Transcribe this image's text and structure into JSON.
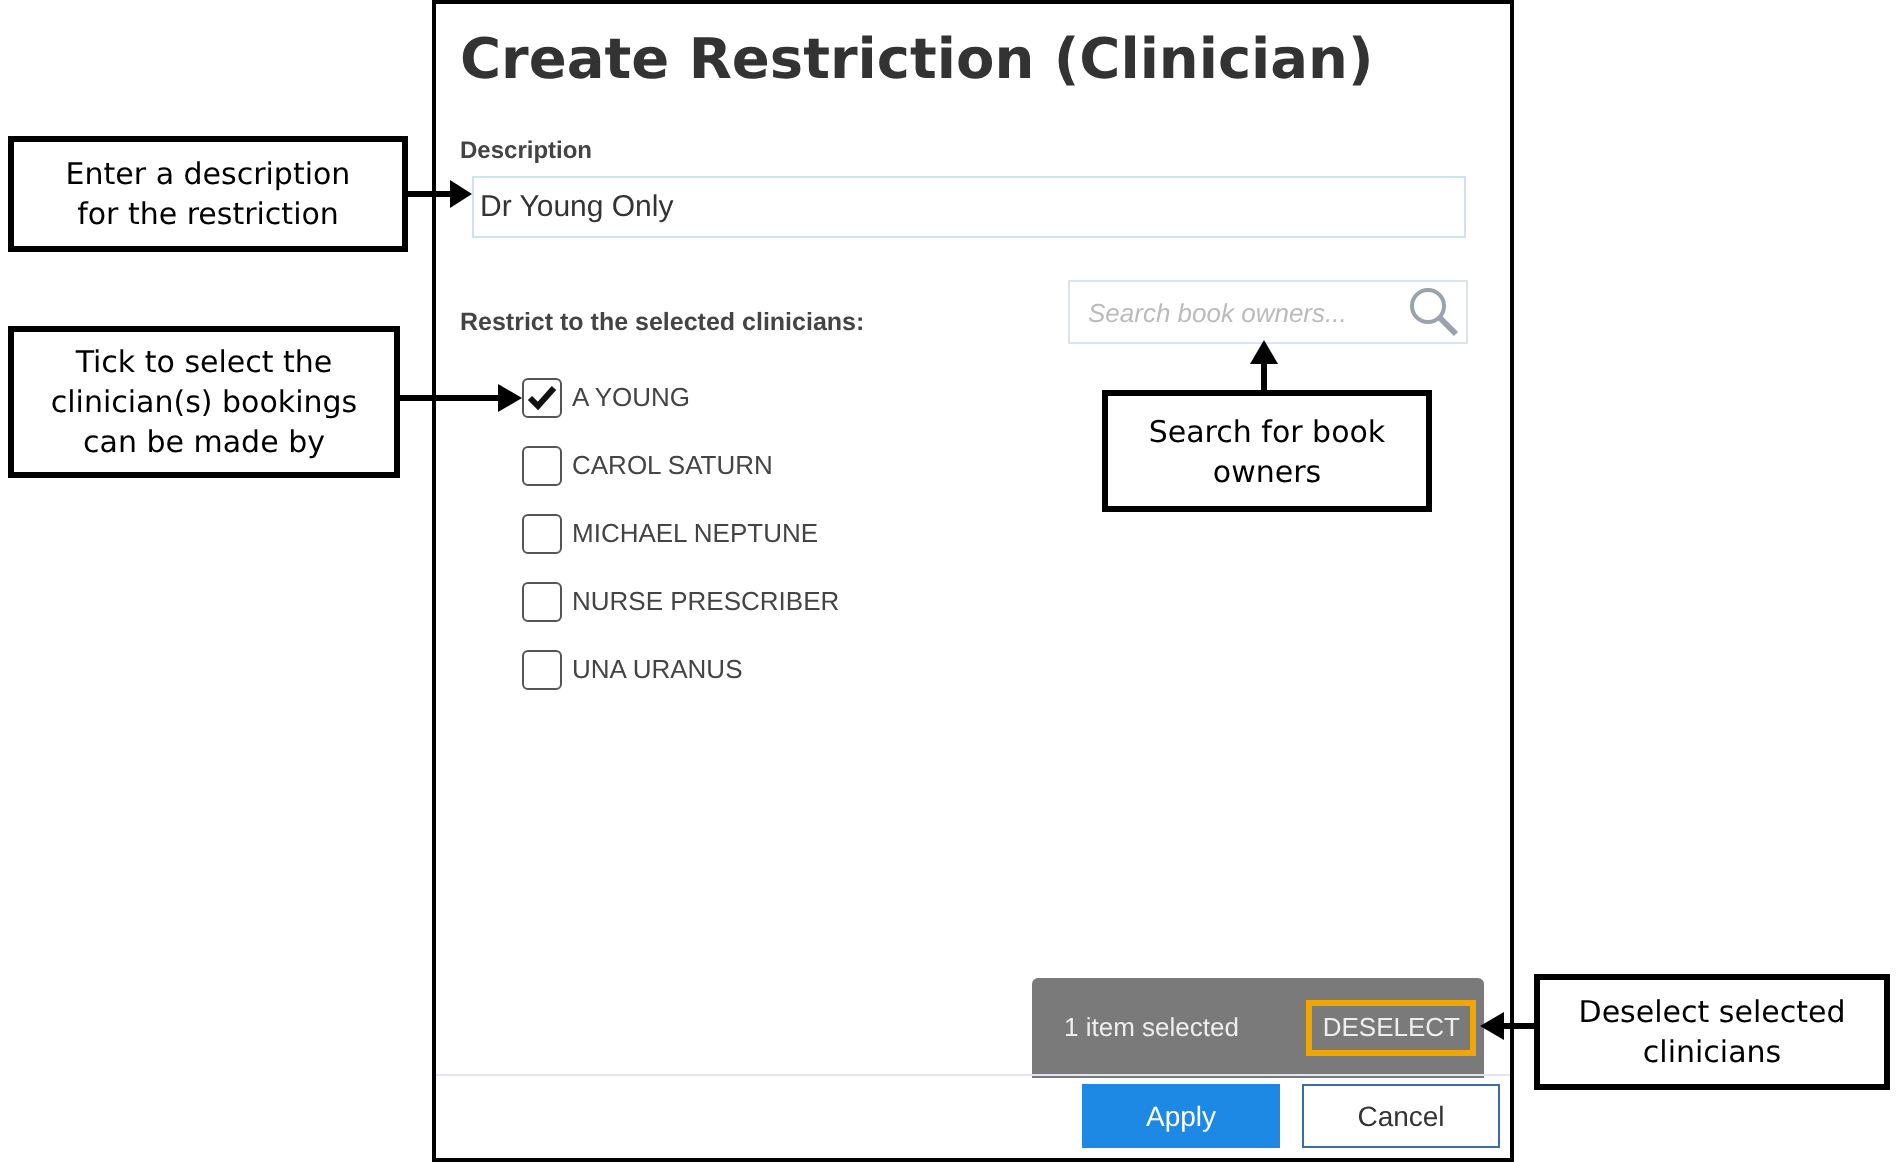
{
  "dialog": {
    "title": "Create Restriction (Clinician)",
    "description": {
      "label": "Description",
      "value": "Dr Young Only"
    },
    "restrict_label": "Restrict to the selected clinicians:",
    "search": {
      "placeholder": "Search book owners..."
    },
    "clinicians": [
      {
        "name": "A YOUNG",
        "checked": true
      },
      {
        "name": "CAROL SATURN",
        "checked": false
      },
      {
        "name": "MICHAEL NEPTUNE",
        "checked": false
      },
      {
        "name": "NURSE PRESCRIBER",
        "checked": false
      },
      {
        "name": "UNA URANUS",
        "checked": false
      }
    ],
    "selection_bar": {
      "count_text": "1 item selected",
      "deselect": "DESELECT"
    },
    "buttons": [
      {
        "label": "Apply",
        "kind": "primary"
      },
      {
        "label": "Cancel",
        "kind": "secondary"
      }
    ]
  },
  "callouts": [
    {
      "text": "Enter a description for the restriction",
      "kind": "left1"
    },
    {
      "text": "Tick to select the clinician(s) bookings can be made by",
      "kind": "left2"
    },
    {
      "text": "Search for book owners",
      "kind": "up"
    },
    {
      "text": "Deselect selected clinicians",
      "kind": "right"
    }
  ]
}
